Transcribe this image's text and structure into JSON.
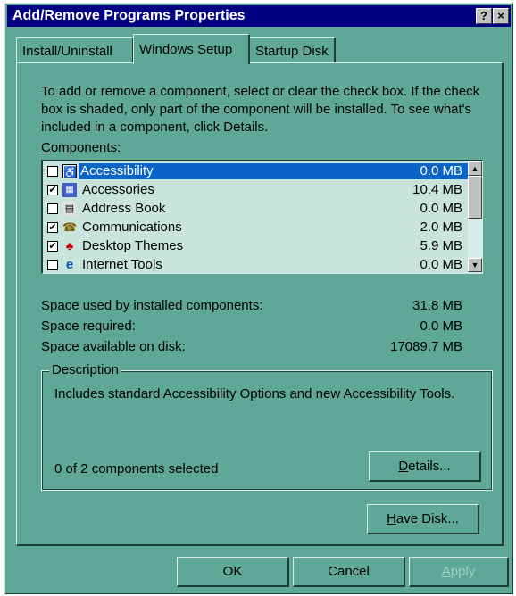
{
  "window": {
    "title": "Add/Remove Programs Properties",
    "help_button": "?",
    "close_button": "×"
  },
  "tabs": [
    {
      "label": "Install/Uninstall",
      "active": false
    },
    {
      "label": "Windows Setup",
      "active": true
    },
    {
      "label": "Startup Disk",
      "active": false
    }
  ],
  "intro_text": "To add or remove a component, select or clear the check box. If the check box is shaded, only part of the component will be installed. To see what's included in a component, click Details.",
  "components_label": "Components:",
  "components": [
    {
      "name": "Accessibility",
      "size": "0.0 MB",
      "checked": false,
      "selected": true,
      "icon": "accessibility-icon"
    },
    {
      "name": "Accessories",
      "size": "10.4 MB",
      "checked": true,
      "selected": false,
      "icon": "accessories-icon"
    },
    {
      "name": "Address Book",
      "size": "0.0 MB",
      "checked": false,
      "selected": false,
      "icon": "address-book-icon"
    },
    {
      "name": "Communications",
      "size": "2.0 MB",
      "checked": true,
      "selected": false,
      "icon": "communications-icon"
    },
    {
      "name": "Desktop Themes",
      "size": "5.9 MB",
      "checked": true,
      "selected": false,
      "icon": "desktop-themes-icon"
    },
    {
      "name": "Internet Tools",
      "size": "0.0 MB",
      "checked": false,
      "selected": false,
      "icon": "internet-tools-icon"
    }
  ],
  "space": {
    "used_label": "Space used by installed components:",
    "used_value": "31.8 MB",
    "required_label": "Space required:",
    "required_value": "0.0 MB",
    "available_label": "Space available on disk:",
    "available_value": "17089.7 MB"
  },
  "description": {
    "label": "Description",
    "text": "Includes standard Accessibility Options and new Accessibility Tools.",
    "selected_count": "0 of 2 components selected",
    "details_button": "Details..."
  },
  "have_disk_button": "Have Disk...",
  "footer": {
    "ok": "OK",
    "cancel": "Cancel",
    "apply": "Apply"
  },
  "colors": {
    "window_bg": "#5fa898",
    "title_bar": "#000080",
    "selection": "#0a64c8",
    "list_bg": "#c8e4dc"
  }
}
